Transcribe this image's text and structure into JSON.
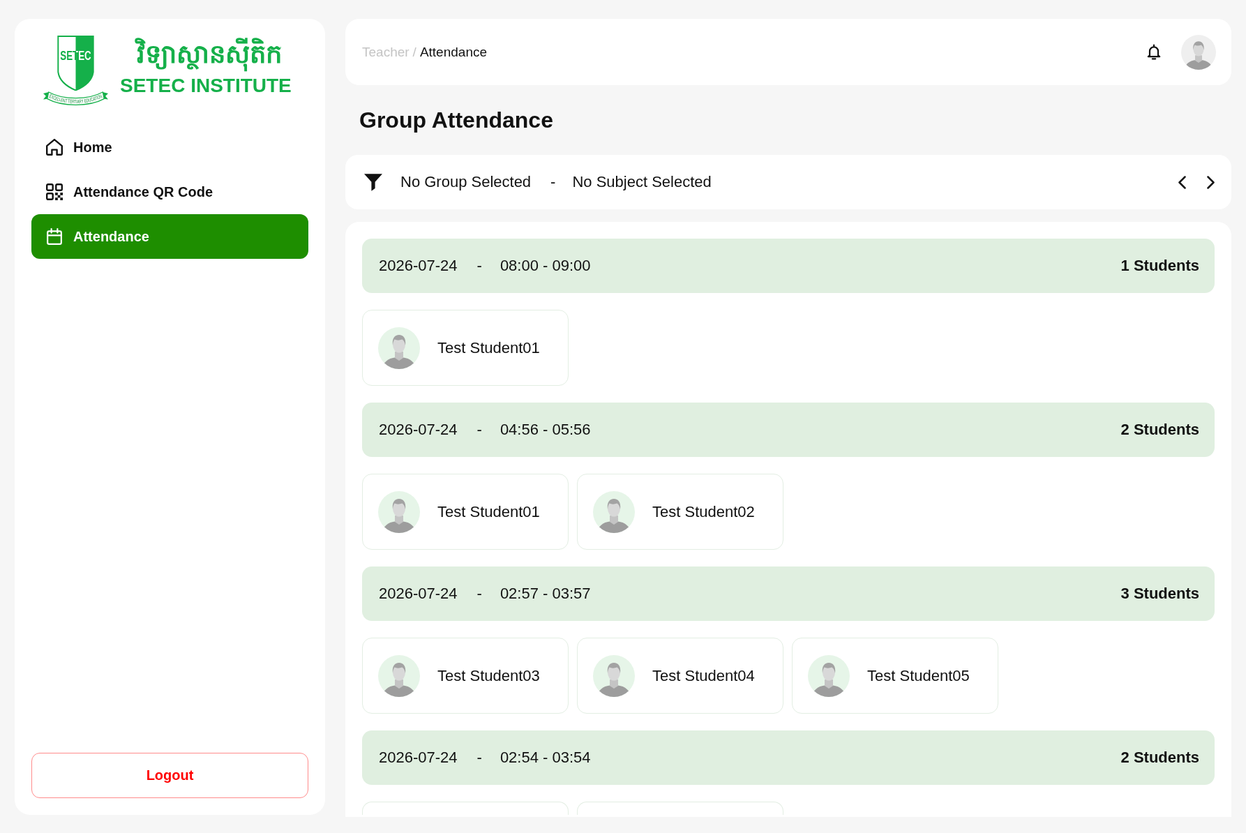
{
  "sidebar": {
    "logo": {
      "emblem_text": "SETEC",
      "motto": "EXCELLENT TERTIARY EDUCATION",
      "name_khmer": "វិទ្យាស្ថានស៊ីតិក",
      "name": "SETEC INSTITUTE"
    },
    "nav_items": [
      {
        "label": "Home",
        "selected": false
      },
      {
        "label": "Attendance QR Code",
        "selected": false
      },
      {
        "label": "Attendance",
        "selected": true
      }
    ],
    "logout": {
      "label": "Logout"
    }
  },
  "header": {
    "breadcrumb": {
      "separator": "/",
      "items": [
        {
          "label": "Teacher",
          "current": false
        },
        {
          "label": "Attendance",
          "current": true
        }
      ]
    }
  },
  "page_title": "Group Attendance",
  "filter_bar": {
    "group": "No Group Selected",
    "separator": "-",
    "subject": "No Subject Selected"
  },
  "sessions": [
    {
      "date": "2026-07-24",
      "separator": "-",
      "time": "08:00 - 09:00",
      "count": "1 Students",
      "students": [
        {
          "kind": "full",
          "name": "Test Student01"
        }
      ]
    },
    {
      "date": "2026-07-24",
      "separator": "-",
      "time": "04:56 - 05:56",
      "count": "2 Students",
      "students": [
        {
          "kind": "full",
          "name": "Test Student01"
        },
        {
          "kind": "full",
          "name": "Test Student02"
        }
      ]
    },
    {
      "date": "2026-07-24",
      "separator": "-",
      "time": "02:57 - 03:57",
      "count": "3 Students",
      "students": [
        {
          "kind": "full",
          "name": "Test Student03"
        },
        {
          "kind": "full",
          "name": "Test Student04"
        },
        {
          "kind": "full",
          "name": "Test Student05"
        }
      ]
    },
    {
      "date": "2026-07-24",
      "separator": "-",
      "time": "02:54 - 03:54",
      "count": "2 Students",
      "students": [
        {
          "kind": "cut_off"
        },
        {
          "kind": "cut_off"
        }
      ]
    }
  ]
}
